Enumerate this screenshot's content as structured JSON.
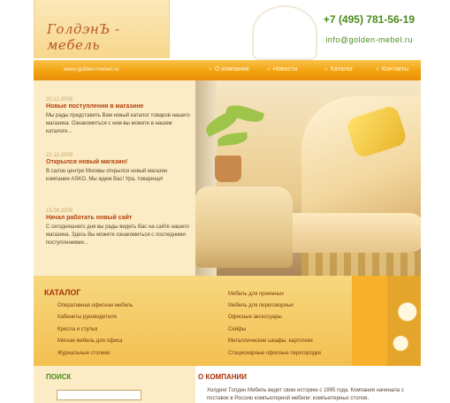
{
  "header": {
    "logo": "ГолдэнЪ - мебель",
    "phone": "+7 (495) 781-56-19",
    "email": "info@golden-mebel.ru"
  },
  "nav": {
    "site": "www.golden-mebel.ru",
    "items": [
      "О компании",
      "Новости",
      "Каталог",
      "Контакты"
    ]
  },
  "news": [
    {
      "date": "20.12.2008",
      "title": "Новые поступления в магазине",
      "text": "Мы рады представить Вам новый каталог товаров нашего магазина. Ознакомиться с ним вы можете в нашем каталоге..."
    },
    {
      "date": "22.12.2008",
      "title": "Открылся новый магазин!",
      "text": "В салон центре Москвы открылся новый магазин компании ASKO. Мы ждем Вас! Ура, товарищи!"
    },
    {
      "date": "15.09.2008",
      "title": "Начал работать новый сайт",
      "text": "С сегодняшнего дня вы рады видеть Вас на сайте нашего магазина. Здесь Вы можете ознакомиться с последними поступлениями..."
    }
  ],
  "catalog": {
    "title": "КАТАЛОГ",
    "left": [
      "Оперативная офисная мебель",
      "Кабинеты руководителя",
      "Кресла и стулья",
      "Мягкая мебель для офиса",
      "Журнальные столики"
    ],
    "right": [
      "Мебель для приемных",
      "Мебель для переговорных",
      "Офисные аксессуары",
      "Сейфы",
      "Металлические шкафы, картотеки",
      "Стационарные офисные перегородки"
    ]
  },
  "search": {
    "title": "ПОИСК",
    "value": ""
  },
  "about": {
    "title": "О КОМПАНИИ",
    "text": "Холдинг Голден Мебель ведет свою историю с 1995 года. Компания начинала с поставок в Россию компьютерной мебели: компьютерных столов,"
  }
}
